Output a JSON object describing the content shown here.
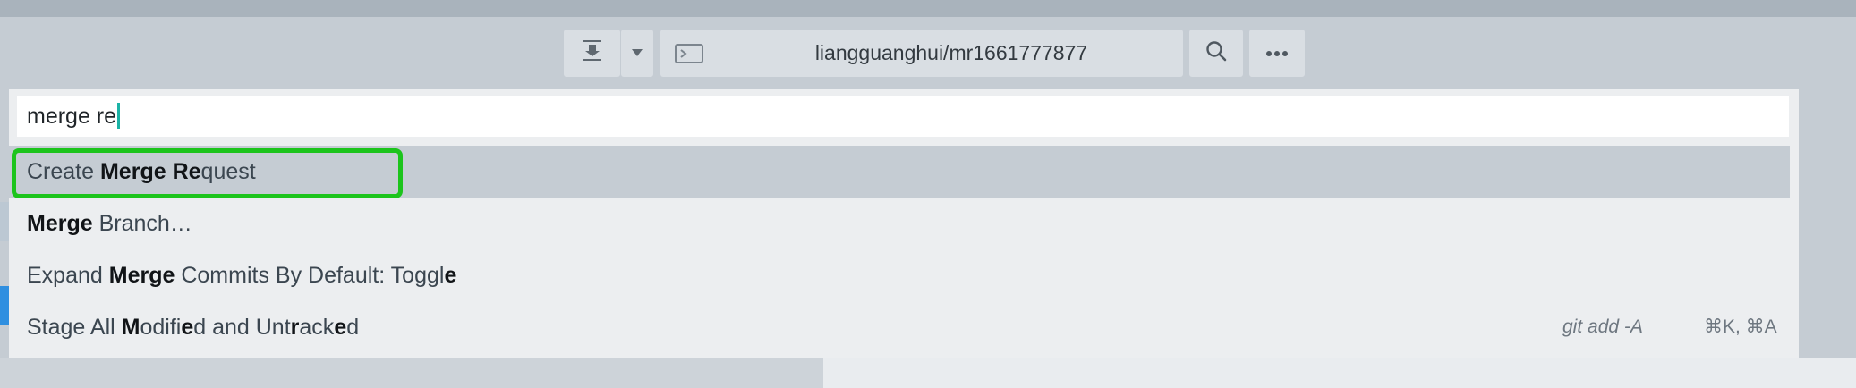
{
  "toolbar": {
    "push_icon": "push-down-arrow-icon",
    "dropdown_icon": "chevron-down-icon",
    "terminal_icon": "terminal-icon",
    "branch": "liangguanghui/mr1661777877",
    "search_icon": "search-icon",
    "more_icon": "more-horizontal-icon"
  },
  "palette": {
    "search_value": "merge re",
    "results": [
      {
        "segments": [
          {
            "text": "Create ",
            "bold": false
          },
          {
            "text": "Merge",
            "bold": true
          },
          {
            "text": " ",
            "bold": false
          },
          {
            "text": "Re",
            "bold": true
          },
          {
            "text": "quest",
            "bold": false
          }
        ],
        "selected": true,
        "command": "",
        "shortcut": ""
      },
      {
        "segments": [
          {
            "text": "Merge",
            "bold": true
          },
          {
            "text": " Branch…",
            "bold": false
          }
        ],
        "selected": false,
        "command": "",
        "shortcut": ""
      },
      {
        "segments": [
          {
            "text": "Expand ",
            "bold": false
          },
          {
            "text": "Merge",
            "bold": true
          },
          {
            "text": " Commits By Default: Toggl",
            "bold": false
          },
          {
            "text": "e",
            "bold": true
          }
        ],
        "selected": false,
        "command": "",
        "shortcut": ""
      },
      {
        "segments": [
          {
            "text": "Stage All ",
            "bold": false
          },
          {
            "text": "M",
            "bold": true
          },
          {
            "text": "odifi",
            "bold": false
          },
          {
            "text": "e",
            "bold": true
          },
          {
            "text": "d and Unt",
            "bold": false
          },
          {
            "text": "r",
            "bold": true
          },
          {
            "text": "ack",
            "bold": false
          },
          {
            "text": "e",
            "bold": true
          },
          {
            "text": "d",
            "bold": false
          }
        ],
        "selected": false,
        "command": "git add -A",
        "shortcut": "⌘K, ⌘A"
      }
    ]
  },
  "colors": {
    "highlight": "#1cc41c",
    "caret": "#1bb3a6",
    "selected_row": "#c5ccd3"
  }
}
